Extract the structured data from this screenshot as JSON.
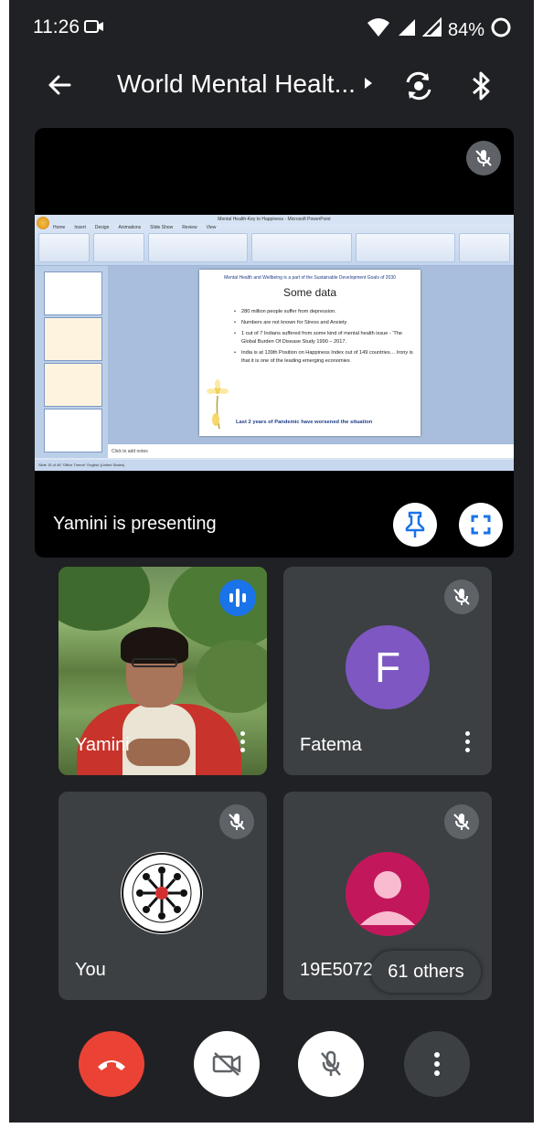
{
  "status_bar": {
    "time": "11:26",
    "battery": "84%"
  },
  "header": {
    "title": "World Mental Healt..."
  },
  "presentation": {
    "presenter_label": "Yamini is presenting",
    "ppt_window_title": "Mental Health-Key to Happiness - Microsoft PowerPoint",
    "ppt_tabs": [
      "Home",
      "Insert",
      "Design",
      "Animations",
      "Slide Show",
      "Review",
      "View"
    ],
    "slide": {
      "banner": "Mental Health and Wellbeing is a part of the Sustainable Development Goals of 2030",
      "heading": "Some data",
      "bullets": [
        "280 million people suffer from depression.",
        "Numbers are not known for Stress and Anxiety",
        "1 out of 7  Indians suffered  from some kind of mental health issue - 'The Global Burden Of Disease Study 1990 – 2017.",
        "India is at 139th Position on Happiness Index out of 149 countries…  Irony is that it is one of the leading emerging economies"
      ],
      "footer": "Last 2 years of Pandemic have worsened the situation"
    },
    "notes_placeholder": "Click to add notes",
    "status_text": "Slide 15 of 48   \"Office Theme\"   English (United States)"
  },
  "participants": [
    {
      "name": "Yamini"
    },
    {
      "name": "Fatema",
      "initial": "F"
    },
    {
      "name": "You"
    },
    {
      "name": "19E5072_"
    }
  ],
  "others_badge": "61 others",
  "colors": {
    "end_call": "#ea4335",
    "avatar_fatema": "#7e57c2",
    "avatar_generic": "#c2185b",
    "speaking": "#1a73e8"
  }
}
